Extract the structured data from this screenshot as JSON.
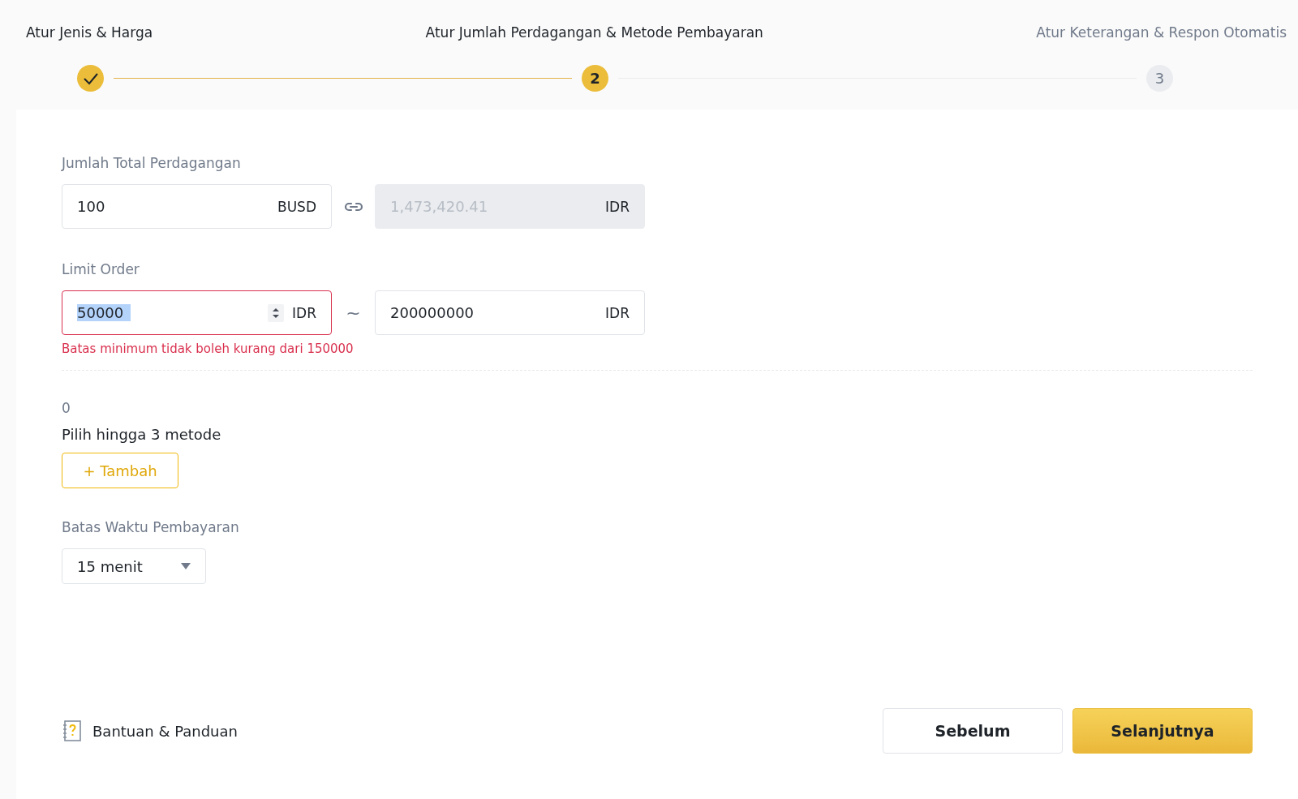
{
  "steps": [
    {
      "label": "Atur Jenis & Harga",
      "completed": true,
      "selected": false
    },
    {
      "label": "Atur Jumlah Perdagangan & Metode Pembayaran",
      "number": "2",
      "completed": false,
      "selected": true
    },
    {
      "label": "Atur Keterangan & Respon Otomatis",
      "number": "3",
      "completed": false,
      "selected": false
    }
  ],
  "total_amount": {
    "label": "Jumlah Total Perdagangan",
    "crypto": {
      "value": "100",
      "unit": "BUSD",
      "disabled": false
    },
    "fiat": {
      "value": "1,473,420.41",
      "unit": "IDR",
      "disabled": true
    }
  },
  "limit_order": {
    "label": "Limit Order",
    "separator": "~",
    "min": {
      "value": "50000",
      "unit": "IDR",
      "error": true,
      "highlighted": true
    },
    "max": {
      "value": "200000000",
      "unit": "IDR",
      "error": false,
      "highlighted": false
    },
    "error_message": "Batas minimum tidak boleh kurang dari 150000"
  },
  "payment_methods": {
    "count": "0",
    "hint": "Pilih hingga 3 metode",
    "add_button": "+ Tambah"
  },
  "payment_time": {
    "label": "Batas Waktu Pembayaran",
    "value": "15 menit"
  },
  "footer": {
    "help_link": "Bantuan & Panduan",
    "back_button": "Sebelum",
    "next_button": "Selanjutnya"
  }
}
